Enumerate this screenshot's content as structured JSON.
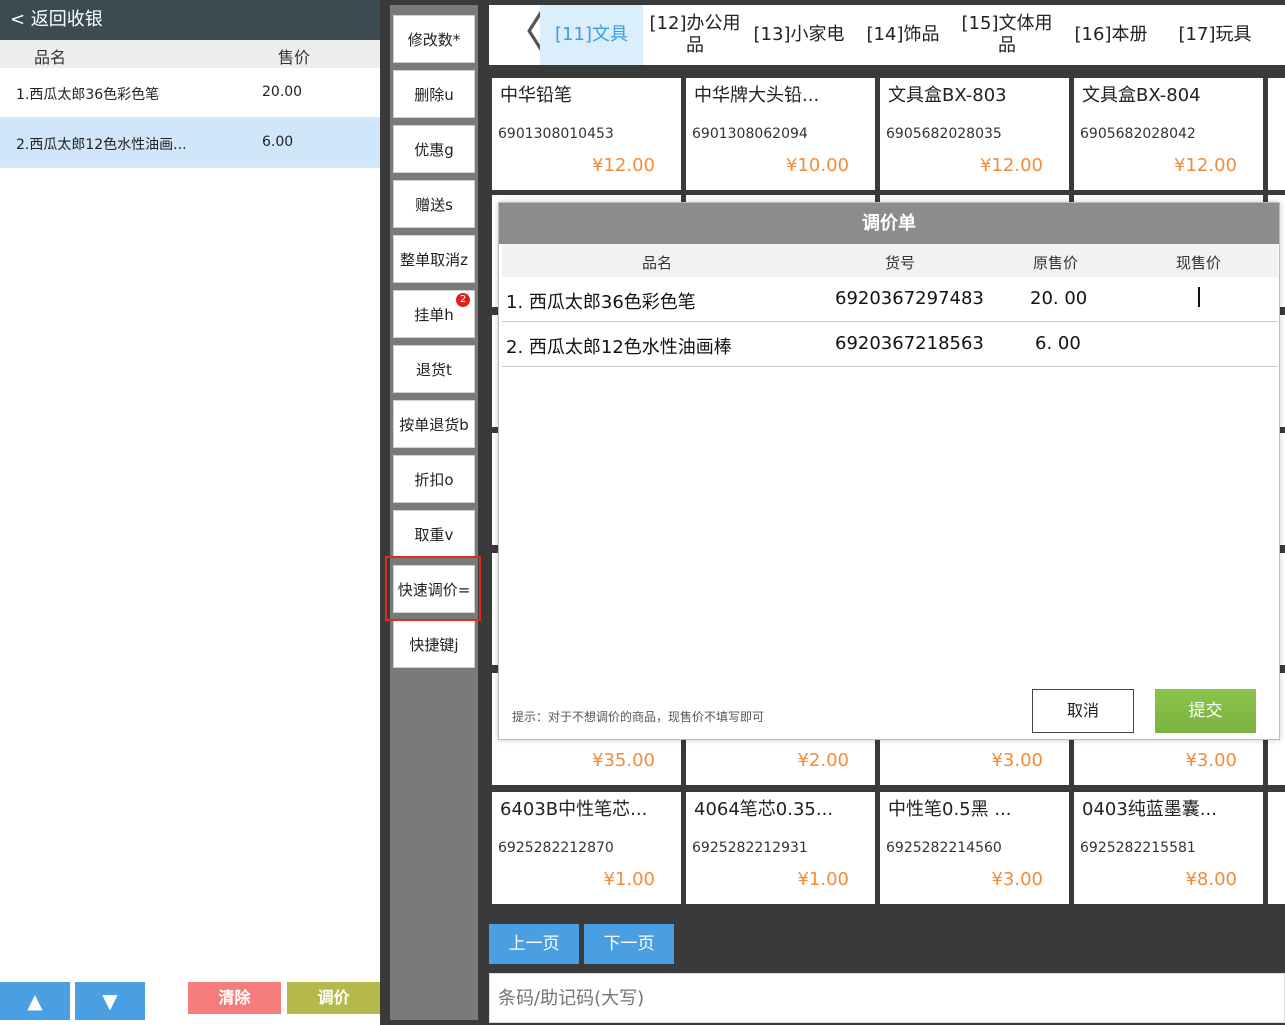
{
  "left_panel": {
    "back_label": "< 返回收银",
    "col_name": "品名",
    "col_price": "售价",
    "items": [
      {
        "name": "1.西瓜太郎36色彩色笔",
        "price": "20.00"
      },
      {
        "name": "2.西瓜太郎12色水性油画...",
        "price": "6.00"
      }
    ],
    "up_arrow": "▲",
    "down_arrow": "▼",
    "clear_label": "清除",
    "adjust_label": "调价"
  },
  "functions": {
    "items": [
      "修改数*",
      "删除u",
      "优惠g",
      "赠送s",
      "整单取消z",
      "挂单h",
      "退货t",
      "按单退货b",
      "折扣o",
      "取重v",
      "快速调价=",
      "快捷键j"
    ],
    "hold_badge": "2"
  },
  "tabs": {
    "prev_symbol": "〈",
    "items": [
      "[11]文具",
      "[12]办公用品",
      "[13]小家电",
      "[14]饰品",
      "[15]文体用品",
      "[16]本册",
      "[17]玩具"
    ],
    "active": "[11]文具"
  },
  "products": [
    {
      "name": "中华铅笔",
      "code": "6901308010453",
      "price": "¥12.00"
    },
    {
      "name": "中华牌大头铅...",
      "code": "6901308062094",
      "price": "¥10.00"
    },
    {
      "name": "文具盒BX-803",
      "code": "6905682028035",
      "price": "¥12.00"
    },
    {
      "name": "文具盒BX-804",
      "code": "6905682028042",
      "price": "¥12.00"
    },
    {
      "name": "",
      "code": "",
      "price": "¥35.00"
    },
    {
      "name": "",
      "code": "",
      "price": "¥2.00"
    },
    {
      "name": "",
      "code": "",
      "price": "¥3.00"
    },
    {
      "name": "",
      "code": "",
      "price": "¥3.00"
    },
    {
      "name": "6403B中性笔芯...",
      "code": "6925282212870",
      "price": "¥1.00"
    },
    {
      "name": "4064笔芯0.35...",
      "code": "6925282212931",
      "price": "¥1.00"
    },
    {
      "name": "中性笔0.5黑 ...",
      "code": "6925282214560",
      "price": "¥3.00"
    },
    {
      "name": "0403纯蓝墨囊...",
      "code": "6925282215581",
      "price": "¥8.00"
    }
  ],
  "pager": {
    "prev_label": "上一页",
    "next_label": "下一页"
  },
  "barcode": {
    "placeholder": "条码/助记码(大写)"
  },
  "modal": {
    "title": "调价单",
    "col_name": "品名",
    "col_code": "货号",
    "col_orig": "原售价",
    "col_new": "现售价",
    "rows": [
      {
        "name": "1. 西瓜太郎36色彩色笔",
        "code": "6920367297483",
        "orig": "20. 00",
        "new": ""
      },
      {
        "name": "2. 西瓜太郎12色水性油画棒",
        "code": "6920367218563",
        "orig": "6. 00",
        "new": ""
      }
    ],
    "hint": "提示：对于不想调价的商品，现售价不填写即可",
    "cancel_label": "取消",
    "submit_label": "提交"
  },
  "colors": {
    "accent": "#4a9fe3",
    "highlight": "#e02b20",
    "price": "#f28c3a",
    "submit": "#8bc34a",
    "clear": "#f47c7c",
    "adjust": "#b5b94a"
  }
}
